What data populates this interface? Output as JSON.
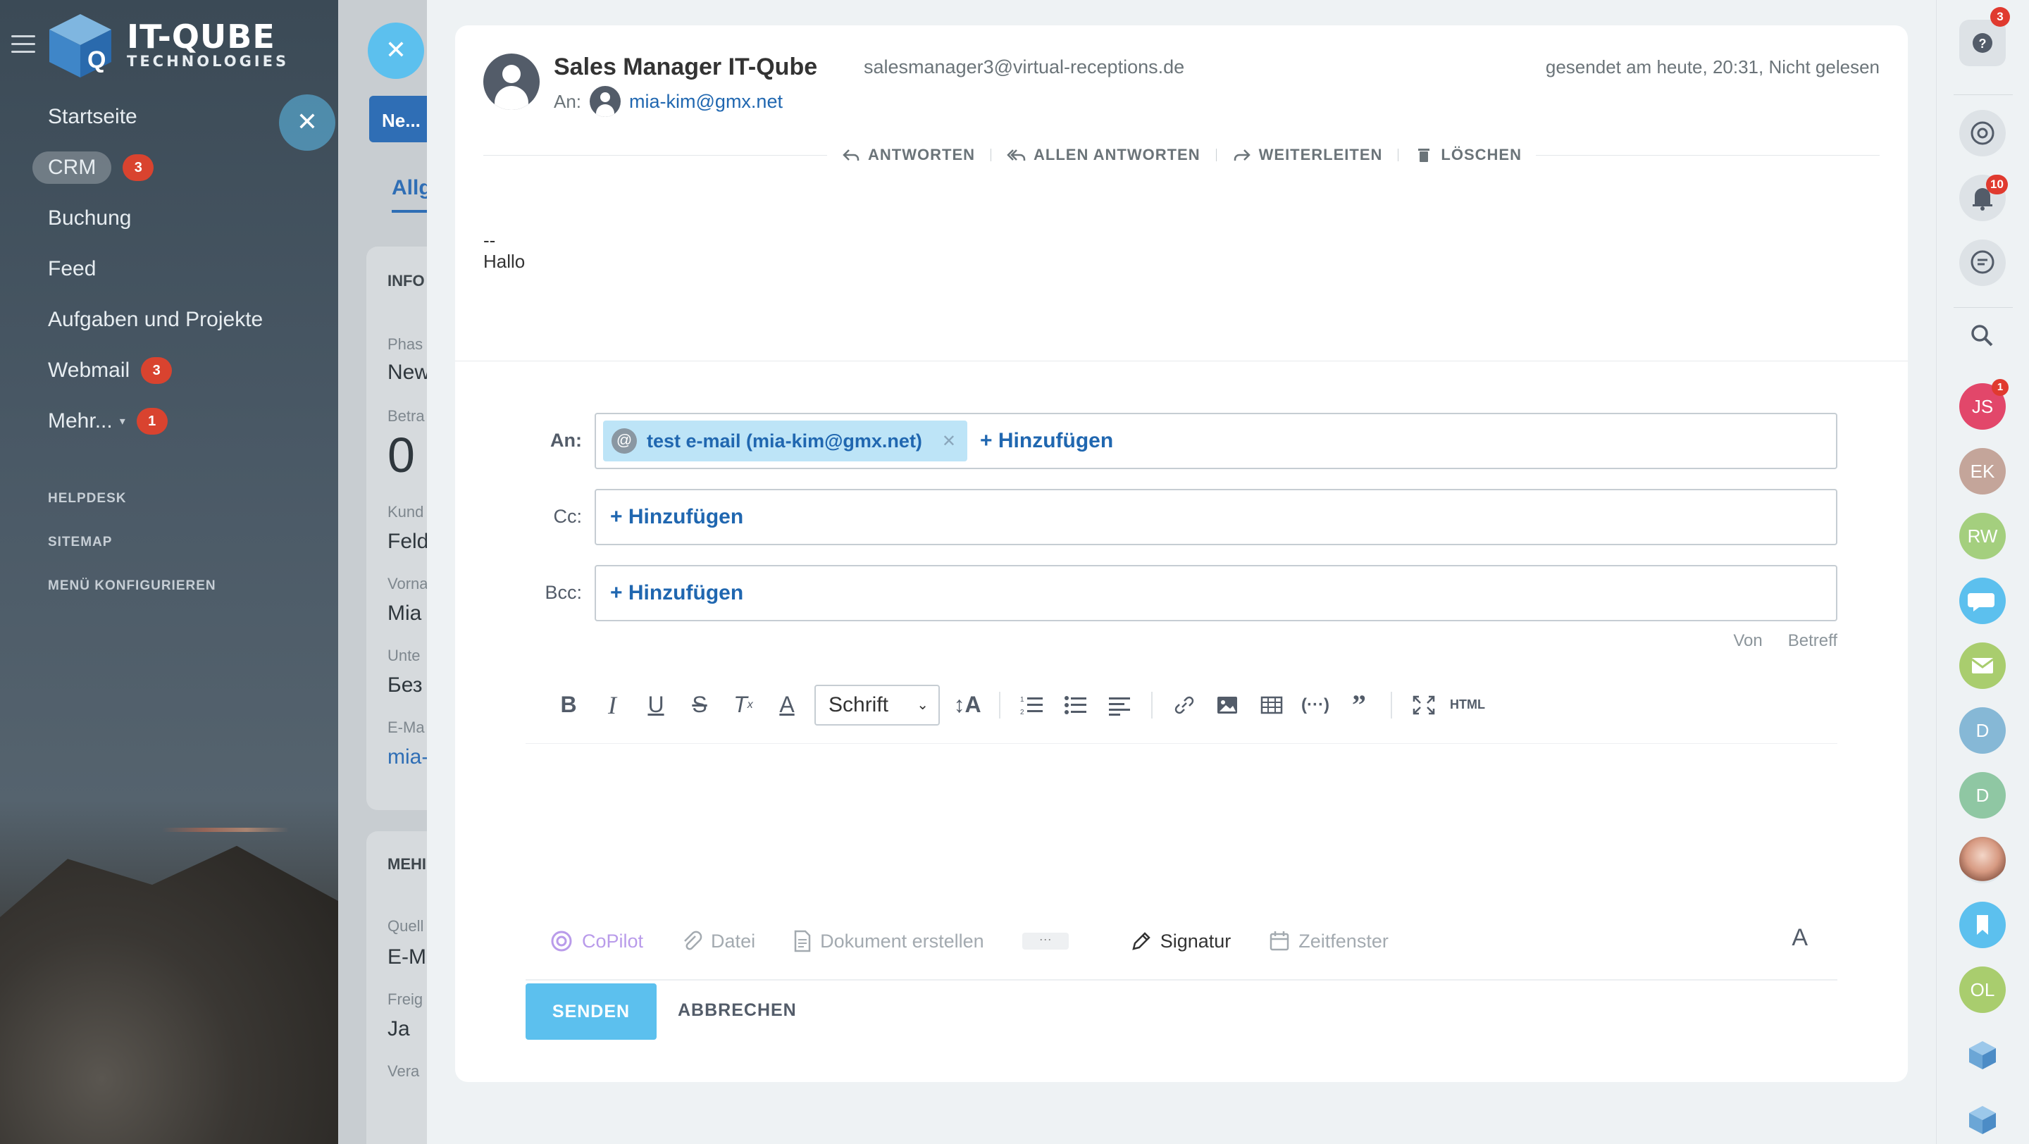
{
  "left_nav": {
    "logo_line1": "IT-QUBE",
    "logo_line2": "TECHNOLOGIES",
    "items": [
      {
        "label": "Startseite",
        "badge": ""
      },
      {
        "label": "CRM",
        "badge": "3"
      },
      {
        "label": "Buchung",
        "badge": ""
      },
      {
        "label": "Feed",
        "badge": ""
      },
      {
        "label": "Aufgaben und Projekte",
        "badge": ""
      },
      {
        "label": "Webmail",
        "badge": "3"
      },
      {
        "label": "Mehr...",
        "badge": "1"
      }
    ],
    "small_links": [
      "HELPDESK",
      "SITEMAP",
      "MENÜ KONFIGURIEREN"
    ]
  },
  "crm_panel": {
    "tab_button": "Ne...",
    "tab_active": "Allg",
    "section_info": "INFO",
    "fields": [
      {
        "label": "Phas",
        "value": "New"
      },
      {
        "label": "Betra",
        "value": "0"
      },
      {
        "label": "Kund",
        "value": "Feld"
      },
      {
        "label": "Vorna",
        "value": "Mia"
      },
      {
        "label": "Unte",
        "value": "Без"
      },
      {
        "label": "E-Ma",
        "value": "mia-"
      }
    ],
    "section_more": "MEHI",
    "fields2": [
      {
        "label": "Quell",
        "value": "E-M"
      },
      {
        "label": "Freig",
        "value": "Ja"
      },
      {
        "label": "Vera",
        "value": ""
      }
    ]
  },
  "email": {
    "sender_name": "Sales Manager IT-Qube",
    "sender_email": "salesmanager3@virtual-receptions.de",
    "sent_info": "gesendet am heute, 20:31, Nicht gelesen",
    "to_label": "An:",
    "to_address": "mia-kim@gmx.net",
    "actions": [
      "ANTWORTEN",
      "ALLEN ANTWORTEN",
      "WEITERLEITEN",
      "LÖSCHEN"
    ],
    "body_line1": "--",
    "body_line2": "Hallo"
  },
  "compose": {
    "to_label": "An:",
    "cc_label": "Cc:",
    "bcc_label": "Bcc:",
    "recipient_chip": "test e-mail (mia-kim@gmx.net)",
    "add_label": "+ Hinzufügen",
    "von_label": "Von",
    "betreff_label": "Betreff",
    "font_select": "Schrift",
    "html_label": "HTML",
    "bottom": {
      "copilot": "CoPilot",
      "datei": "Datei",
      "dokument": "Dokument erstellen",
      "more": "···",
      "signatur": "Signatur",
      "zeitfenster": "Zeitfenster",
      "font_toggle": "A"
    },
    "send": "SENDEN",
    "cancel": "ABBRECHEN"
  },
  "right_rail": {
    "help_badge": "3",
    "notif_badge": "10",
    "avatars": [
      {
        "initials": "JS",
        "color": "#e2476a",
        "badge": "1"
      },
      {
        "initials": "EK",
        "color": "#c4a59a",
        "badge": ""
      },
      {
        "initials": "RW",
        "color": "#a4cf7e",
        "badge": ""
      },
      {
        "initials": "D",
        "color": "#86b8d6",
        "badge": ""
      },
      {
        "initials": "D",
        "color": "#8fc7a3",
        "badge": ""
      },
      {
        "initials": "OL",
        "color": "#a9cd6e",
        "badge": ""
      }
    ]
  }
}
